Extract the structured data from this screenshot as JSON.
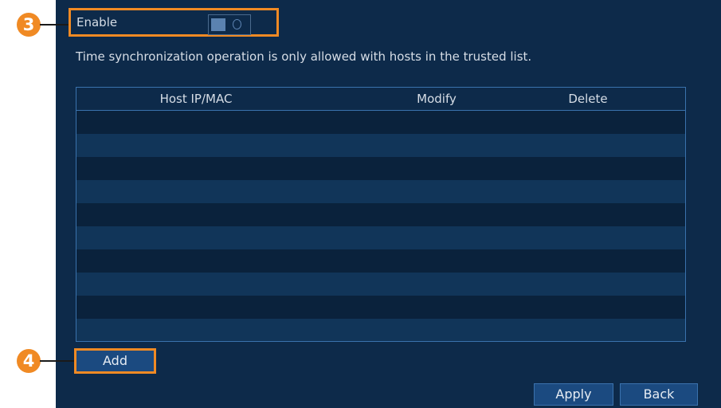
{
  "callouts": {
    "enable_marker": "3",
    "add_marker": "4"
  },
  "enable": {
    "label": "Enable",
    "state": "off"
  },
  "info_text": "Time synchronization operation is only allowed with hosts in the trusted list.",
  "table": {
    "columns": [
      "Host IP/MAC",
      "Modify",
      "Delete"
    ],
    "rows": []
  },
  "buttons": {
    "add": "Add",
    "apply": "Apply",
    "back": "Back"
  },
  "colors": {
    "panel_bg": "#0d2a4a",
    "callout_orange": "#f08a24",
    "button_blue": "#1b4a80"
  }
}
